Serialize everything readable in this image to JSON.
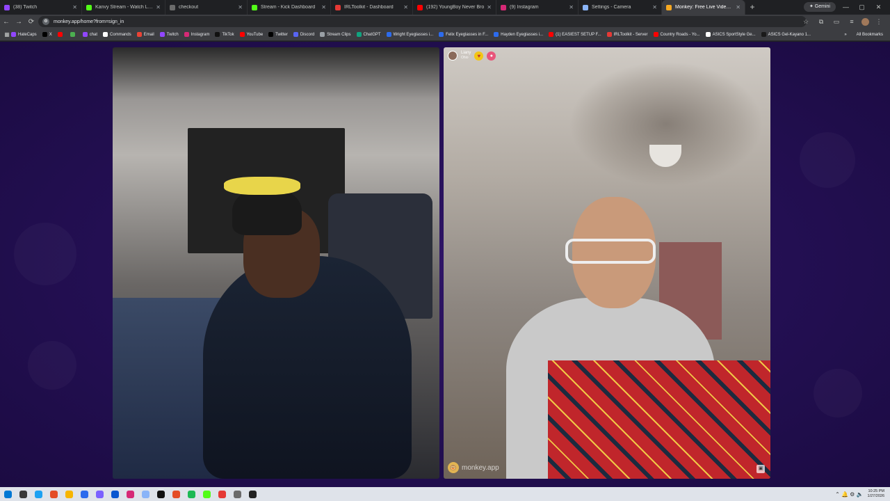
{
  "browser": {
    "tabs": [
      {
        "title": "(38) Twitch",
        "fav": "#9146ff",
        "active": false,
        "width": 118
      },
      {
        "title": "Kanvy Stream - Watch Live on",
        "fav": "#53fc18",
        "active": false,
        "width": 120
      },
      {
        "title": "checkout",
        "fav": "#6b6b6b",
        "active": false,
        "width": 118
      },
      {
        "title": "Stream - Kick Dashboard",
        "fav": "#53fc18",
        "active": false,
        "width": 120
      },
      {
        "title": "IRLToolkit - Dashboard",
        "fav": "#e53935",
        "active": false,
        "width": 118
      },
      {
        "title": "(192) YoungBoy Never Bro",
        "fav": "#ff0000",
        "active": false,
        "width": 120
      },
      {
        "title": "(9) Instagram",
        "fav": "#d62976",
        "active": false,
        "width": 118
      },
      {
        "title": "Settings - Camera",
        "fav": "#8ab4f8",
        "active": false,
        "width": 120
      },
      {
        "title": "Monkey: Free Live Video C",
        "fav": "#f6a821",
        "active": true,
        "width": 120
      }
    ],
    "new_tab_label": "+",
    "gemini_label": "✦ Gemini",
    "window_controls": {
      "minimize": "—",
      "maximize": "▢",
      "close": "✕"
    },
    "toolbar": {
      "back": "←",
      "forward": "→",
      "reload": "⟳",
      "url": "monkey.app/home?from=sign_in",
      "star": "☆"
    },
    "bookmarks": [
      {
        "label": "HateCaps",
        "color": "#9146ff"
      },
      {
        "label": "X",
        "color": "#000000"
      },
      {
        "label": "",
        "color": "#ff0000"
      },
      {
        "label": "",
        "color": "#4caf50"
      },
      {
        "label": "chat",
        "color": "#9146ff"
      },
      {
        "label": "Commands",
        "color": "#ffffff"
      },
      {
        "label": "Email",
        "color": "#ea4335"
      },
      {
        "label": "Twitch",
        "color": "#9146ff"
      },
      {
        "label": "Instagram",
        "color": "#d62976"
      },
      {
        "label": "TikTok",
        "color": "#111111"
      },
      {
        "label": "YouTube",
        "color": "#ff0000"
      },
      {
        "label": "Twitter",
        "color": "#000000"
      },
      {
        "label": "Discord",
        "color": "#5865f2"
      },
      {
        "label": "Stream Clips",
        "color": "#9aa0a6"
      },
      {
        "label": "ChatGPT",
        "color": "#10a37f"
      },
      {
        "label": "Wright Eyeglasses i...",
        "color": "#2c6bed"
      },
      {
        "label": "Felix Eyeglasses in F...",
        "color": "#2c6bed"
      },
      {
        "label": "Hayden Eyeglasses i...",
        "color": "#2c6bed"
      },
      {
        "label": "(1) EASIEST SETUP F...",
        "color": "#ff0000"
      },
      {
        "label": "IRLToolkit - Server",
        "color": "#e53935"
      },
      {
        "label": "Country Roads - Yo...",
        "color": "#ff0000"
      },
      {
        "label": "ASICS SportStyle Ge...",
        "color": "#ffffff"
      },
      {
        "label": "ASICS Gel-Kayano 1...",
        "color": "#1a1a1a"
      }
    ],
    "all_bookmarks": "All Bookmarks",
    "more_bookmarks": "»"
  },
  "call": {
    "remote_user": {
      "name": "Liany",
      "location": "Ohio"
    },
    "heart_icon": "♥",
    "reaction_icon": "●",
    "watermark": "monkey.app",
    "corner_button": "▣"
  },
  "taskbar": {
    "apps": [
      "#0078d4",
      "#3a3a3a",
      "#1da1f2",
      "#e44d26",
      "#f7b500",
      "#2c6bed",
      "#7b61ff",
      "#0b57d0",
      "#d62976",
      "#8ab4f8",
      "#111111",
      "#e44d26",
      "#1db954",
      "#53fc18",
      "#e53935",
      "#6b6b6b",
      "#222222"
    ],
    "tray_icons": "⌃ 🔔 ⚙ 🔈",
    "time": "10:25 PM",
    "date": "1/27/2026"
  }
}
